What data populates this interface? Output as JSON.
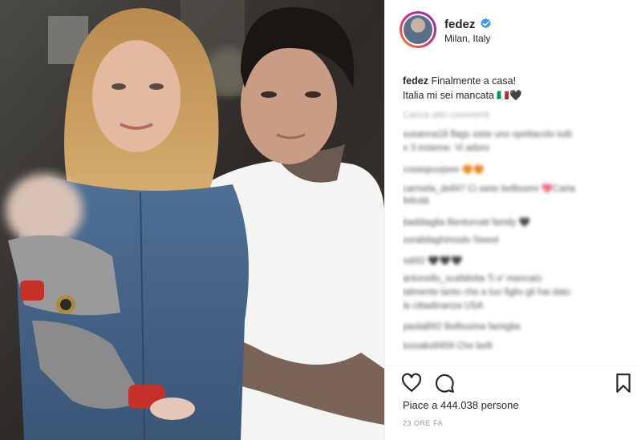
{
  "post": {
    "username": "fedez",
    "location": "Milan, Italy",
    "caption_user": "fedez",
    "caption_line1": "Finalmente a casa!",
    "caption_line2": "Italia mi sei mancata 🇮🇹🖤",
    "load_more": "Carica altri commenti",
    "comments": [
      "susanna18 flags siete uno spettacolo tutti",
      "e 3 insieme. Vi adoro",
      "cosaspuojsee 😍😍",
      "carmela_dell47 Ci siete bellissimi 💖Carta",
      "felicità",
      "baddiaglia Bentornati family 🖤",
      "sorabilaghimodo Sweet",
      "odi92 🖤🖤🖤",
      "antonello_scafaletta Ti e' mancato",
      "talmente tanto che a tuo figlio gli hai dato",
      "la cittadinanza USA",
      "paolaB92 Bellissima famiglia",
      "lussaks8459 Che belli"
    ],
    "likes_text": "Piace a 444.038 persone",
    "time_text": "23 ORE FA"
  },
  "icons": {
    "verified": "verified-badge-icon",
    "like": "heart-icon",
    "comment": "comment-bubble-icon",
    "save": "bookmark-icon"
  },
  "colors": {
    "verified": "#3897f0",
    "text": "#262626",
    "muted": "#999999"
  }
}
